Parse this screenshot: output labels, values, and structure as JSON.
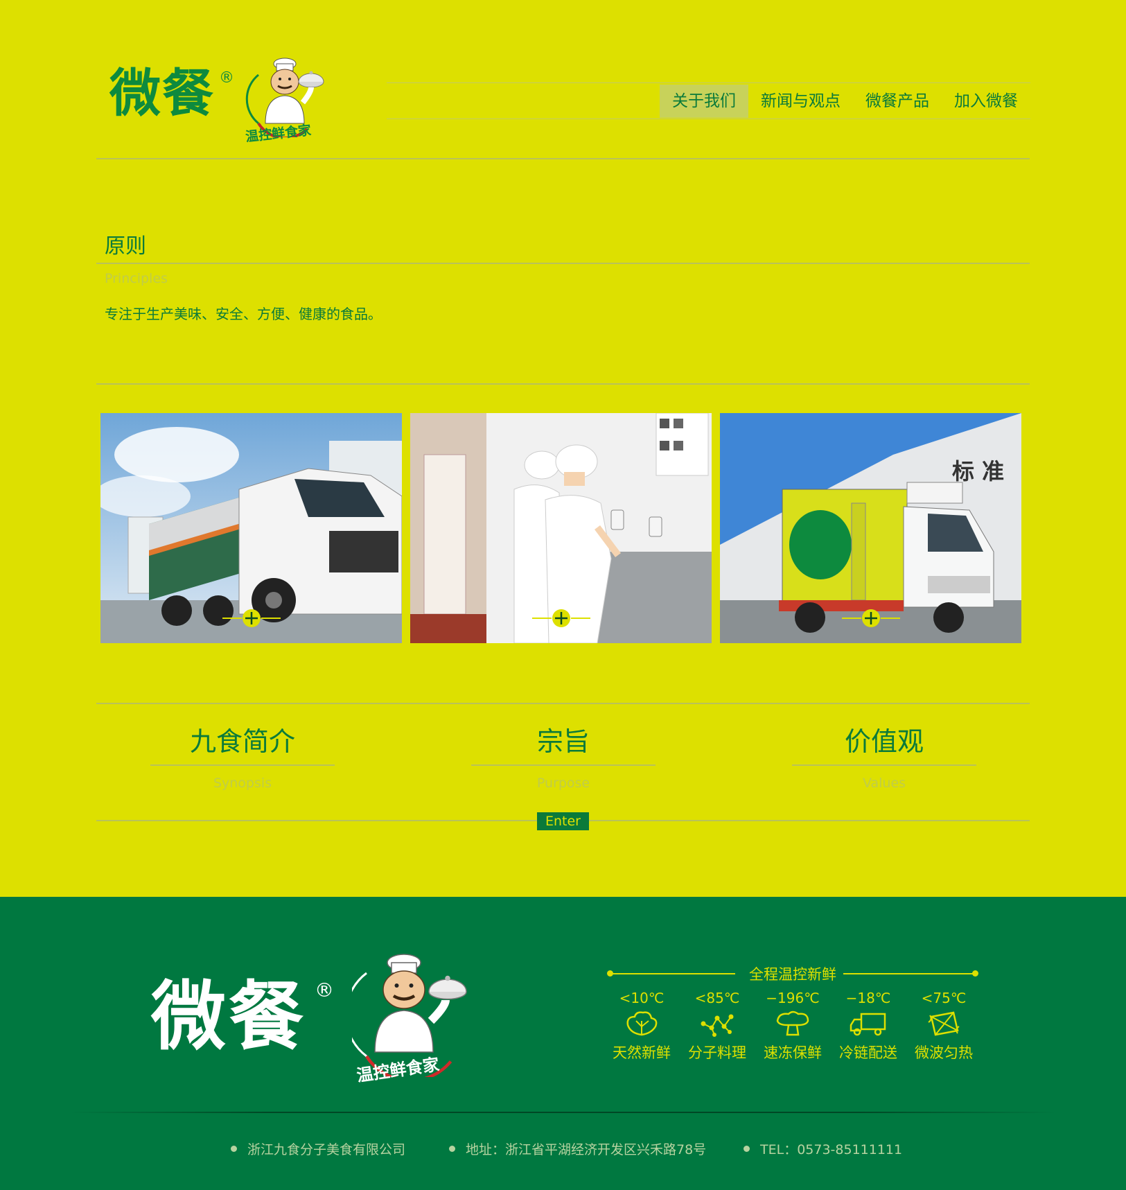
{
  "header": {
    "logo_text": "微餐",
    "logo_reg": "®",
    "logo_slogan": "温控鲜食家"
  },
  "nav": {
    "items": [
      "关于我们",
      "新闻与观点",
      "微餐产品",
      "加入微餐"
    ],
    "active_index": 0
  },
  "principles": {
    "title": "原则",
    "subtitle": "Principles",
    "text": "专注于生产美味、安全、方便、健康的食品。"
  },
  "photos": [
    {
      "icon": "plus-icon",
      "subject": "tanker-truck"
    },
    {
      "icon": "plus-icon",
      "subject": "workers-washing"
    },
    {
      "icon": "plus-icon",
      "subject": "refrigerated-truck"
    }
  ],
  "sections": [
    {
      "title": "九食简介",
      "subtitle": "Synopsis"
    },
    {
      "title": "宗旨",
      "subtitle": "Purpose"
    },
    {
      "title": "价值观",
      "subtitle": "Values"
    }
  ],
  "enter_label": "Enter",
  "footer": {
    "logo_text": "微餐",
    "logo_reg": "®",
    "logo_slogan": "温控鲜食家",
    "features_title": "全程温控新鲜",
    "features": [
      {
        "temp": "<10℃",
        "label": "天然新鲜",
        "icon": "vegetable-icon"
      },
      {
        "temp": "<85℃",
        "label": "分子料理",
        "icon": "molecule-icon"
      },
      {
        "temp": "−196℃",
        "label": "速冻保鲜",
        "icon": "mushroom-cloud-icon"
      },
      {
        "temp": "−18℃",
        "label": "冷链配送",
        "icon": "truck-icon"
      },
      {
        "temp": "<75℃",
        "label": "微波匀热",
        "icon": "microwave-icon"
      }
    ],
    "company": "浙江九食分子美食有限公司",
    "address": "地址：浙江省平湖经济开发区兴禾路78号",
    "tel": "TEL：0573-85111111"
  },
  "colors": {
    "background": "#dde000",
    "primary_green": "#0a7a3a",
    "footer_green": "#007840"
  }
}
